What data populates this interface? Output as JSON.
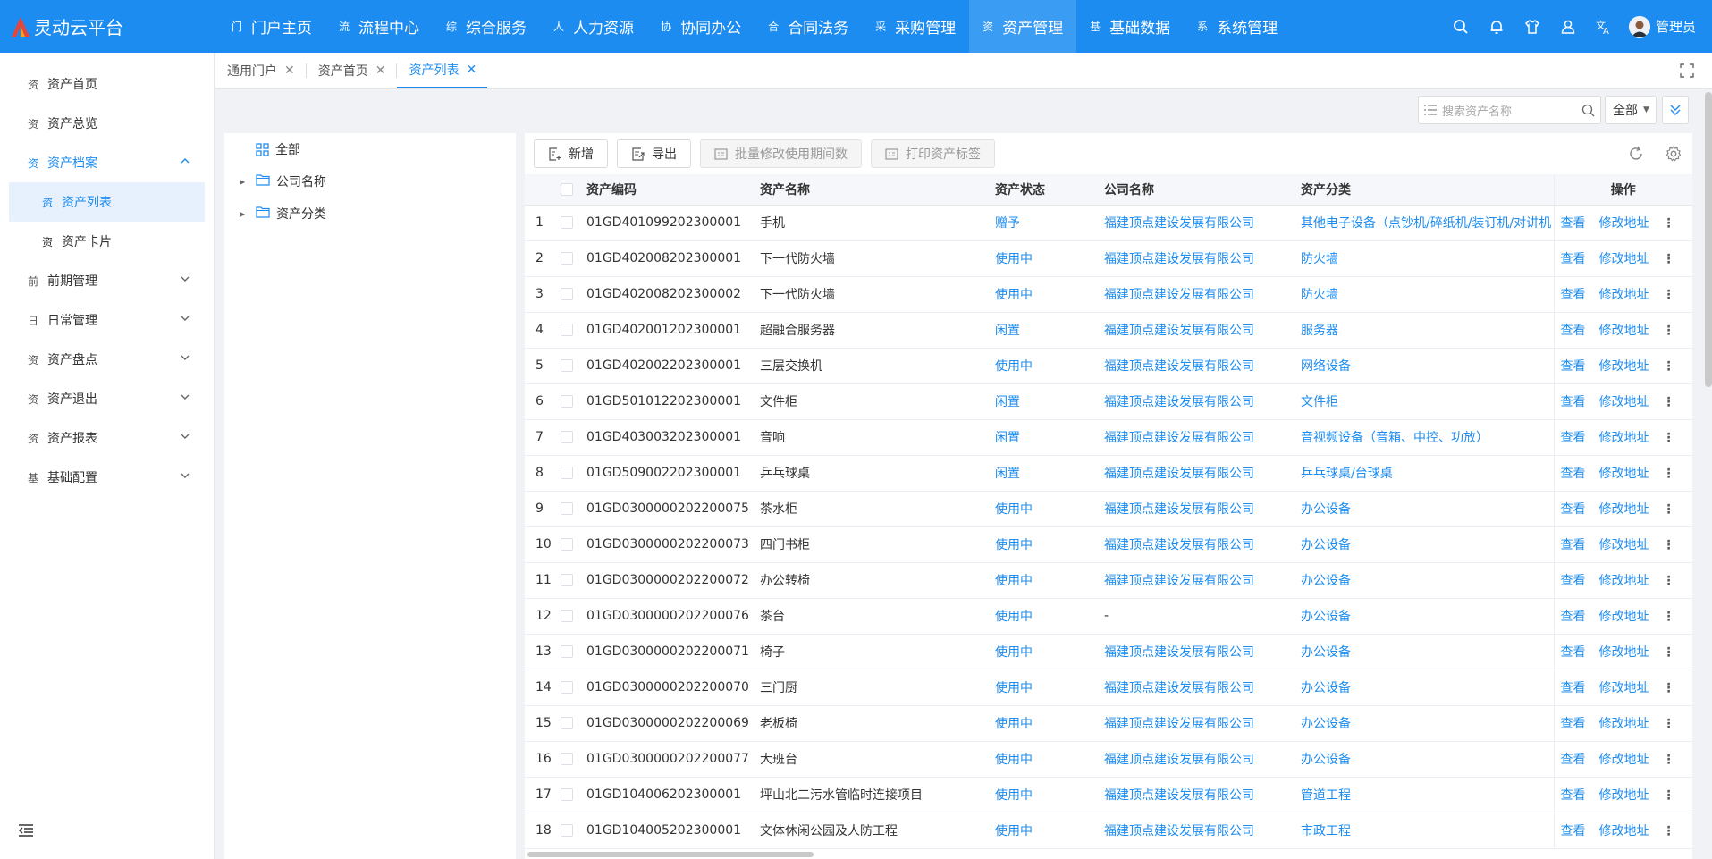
{
  "app": {
    "name": "灵动云平台",
    "brand_color": "#1d8cf0"
  },
  "nav": [
    {
      "icon": "门",
      "label": "门户主页"
    },
    {
      "icon": "流",
      "label": "流程中心"
    },
    {
      "icon": "综",
      "label": "综合服务"
    },
    {
      "icon": "人",
      "label": "人力资源"
    },
    {
      "icon": "协",
      "label": "协同办公"
    },
    {
      "icon": "合",
      "label": "合同法务"
    },
    {
      "icon": "采",
      "label": "采购管理"
    },
    {
      "icon": "资",
      "label": "资产管理",
      "active": true
    },
    {
      "icon": "基",
      "label": "基础数据"
    },
    {
      "icon": "系",
      "label": "系统管理"
    }
  ],
  "user": {
    "name": "管理员"
  },
  "sidebar": {
    "items": [
      {
        "icon": "资",
        "label": "资产首页"
      },
      {
        "icon": "资",
        "label": "资产总览"
      },
      {
        "icon": "资",
        "label": "资产档案",
        "open": true
      },
      {
        "icon": "资",
        "label": "资产列表",
        "sub": true,
        "active": true
      },
      {
        "icon": "资",
        "label": "资产卡片",
        "sub": true
      },
      {
        "icon": "前",
        "label": "前期管理"
      },
      {
        "icon": "日",
        "label": "日常管理"
      },
      {
        "icon": "资",
        "label": "资产盘点"
      },
      {
        "icon": "资",
        "label": "资产退出"
      },
      {
        "icon": "资",
        "label": "资产报表"
      },
      {
        "icon": "基",
        "label": "基础配置"
      }
    ]
  },
  "tabs": [
    {
      "label": "通用门户"
    },
    {
      "label": "资产首页"
    },
    {
      "label": "资产列表",
      "active": true
    }
  ],
  "search": {
    "placeholder": "搜索资产名称",
    "scope": "全部"
  },
  "tree": {
    "root": "全部",
    "nodes": [
      "公司名称",
      "资产分类"
    ]
  },
  "toolbar": {
    "add": "新增",
    "export": "导出",
    "batch_edit": "批量修改使用期间数",
    "print_label": "打印资产标签"
  },
  "table": {
    "headers": {
      "code": "资产编码",
      "name": "资产名称",
      "status": "资产状态",
      "company": "公司名称",
      "category": "资产分类",
      "ops": "操作"
    },
    "op_view": "查看",
    "op_edit": "修改地址",
    "rows": [
      {
        "idx": "1",
        "code": "01GD401099202300001",
        "name": "手机",
        "status": "赠予",
        "company": "福建顶点建设发展有限公司",
        "category": "其他电子设备（点钞机/碎纸机/装订机/对讲机"
      },
      {
        "idx": "2",
        "code": "01GD402008202300001",
        "name": "下一代防火墙",
        "status": "使用中",
        "company": "福建顶点建设发展有限公司",
        "category": "防火墙"
      },
      {
        "idx": "3",
        "code": "01GD402008202300002",
        "name": "下一代防火墙",
        "status": "使用中",
        "company": "福建顶点建设发展有限公司",
        "category": "防火墙"
      },
      {
        "idx": "4",
        "code": "01GD402001202300001",
        "name": "超融合服务器",
        "status": "闲置",
        "company": "福建顶点建设发展有限公司",
        "category": "服务器"
      },
      {
        "idx": "5",
        "code": "01GD402002202300001",
        "name": "三层交换机",
        "status": "使用中",
        "company": "福建顶点建设发展有限公司",
        "category": "网络设备"
      },
      {
        "idx": "6",
        "code": "01GD501012202300001",
        "name": "文件柜",
        "status": "闲置",
        "company": "福建顶点建设发展有限公司",
        "category": "文件柜"
      },
      {
        "idx": "7",
        "code": "01GD403003202300001",
        "name": "音响",
        "status": "闲置",
        "company": "福建顶点建设发展有限公司",
        "category": "音视频设备（音箱、中控、功放）"
      },
      {
        "idx": "8",
        "code": "01GD509002202300001",
        "name": "乒乓球桌",
        "status": "闲置",
        "company": "福建顶点建设发展有限公司",
        "category": "乒乓球桌/台球桌"
      },
      {
        "idx": "9",
        "code": "01GD0300000202200075",
        "name": "茶水柜",
        "status": "使用中",
        "company": "福建顶点建设发展有限公司",
        "category": "办公设备"
      },
      {
        "idx": "10",
        "code": "01GD0300000202200073",
        "name": "四门书柜",
        "status": "使用中",
        "company": "福建顶点建设发展有限公司",
        "category": "办公设备"
      },
      {
        "idx": "11",
        "code": "01GD0300000202200072",
        "name": "办公转椅",
        "status": "使用中",
        "company": "福建顶点建设发展有限公司",
        "category": "办公设备"
      },
      {
        "idx": "12",
        "code": "01GD0300000202200076",
        "name": "茶台",
        "status": "使用中",
        "company": "-",
        "category": "办公设备"
      },
      {
        "idx": "13",
        "code": "01GD0300000202200071",
        "name": "椅子",
        "status": "使用中",
        "company": "福建顶点建设发展有限公司",
        "category": "办公设备"
      },
      {
        "idx": "14",
        "code": "01GD0300000202200070",
        "name": "三门厨",
        "status": "使用中",
        "company": "福建顶点建设发展有限公司",
        "category": "办公设备"
      },
      {
        "idx": "15",
        "code": "01GD0300000202200069",
        "name": "老板椅",
        "status": "使用中",
        "company": "福建顶点建设发展有限公司",
        "category": "办公设备"
      },
      {
        "idx": "16",
        "code": "01GD0300000202200077",
        "name": "大班台",
        "status": "使用中",
        "company": "福建顶点建设发展有限公司",
        "category": "办公设备"
      },
      {
        "idx": "17",
        "code": "01GD104006202300001",
        "name": "坪山北二污水管临时连接项目",
        "status": "使用中",
        "company": "福建顶点建设发展有限公司",
        "category": "管道工程"
      },
      {
        "idx": "18",
        "code": "01GD104005202300001",
        "name": "文体休闲公园及人防工程",
        "status": "使用中",
        "company": "福建顶点建设发展有限公司",
        "category": "市政工程"
      }
    ]
  }
}
